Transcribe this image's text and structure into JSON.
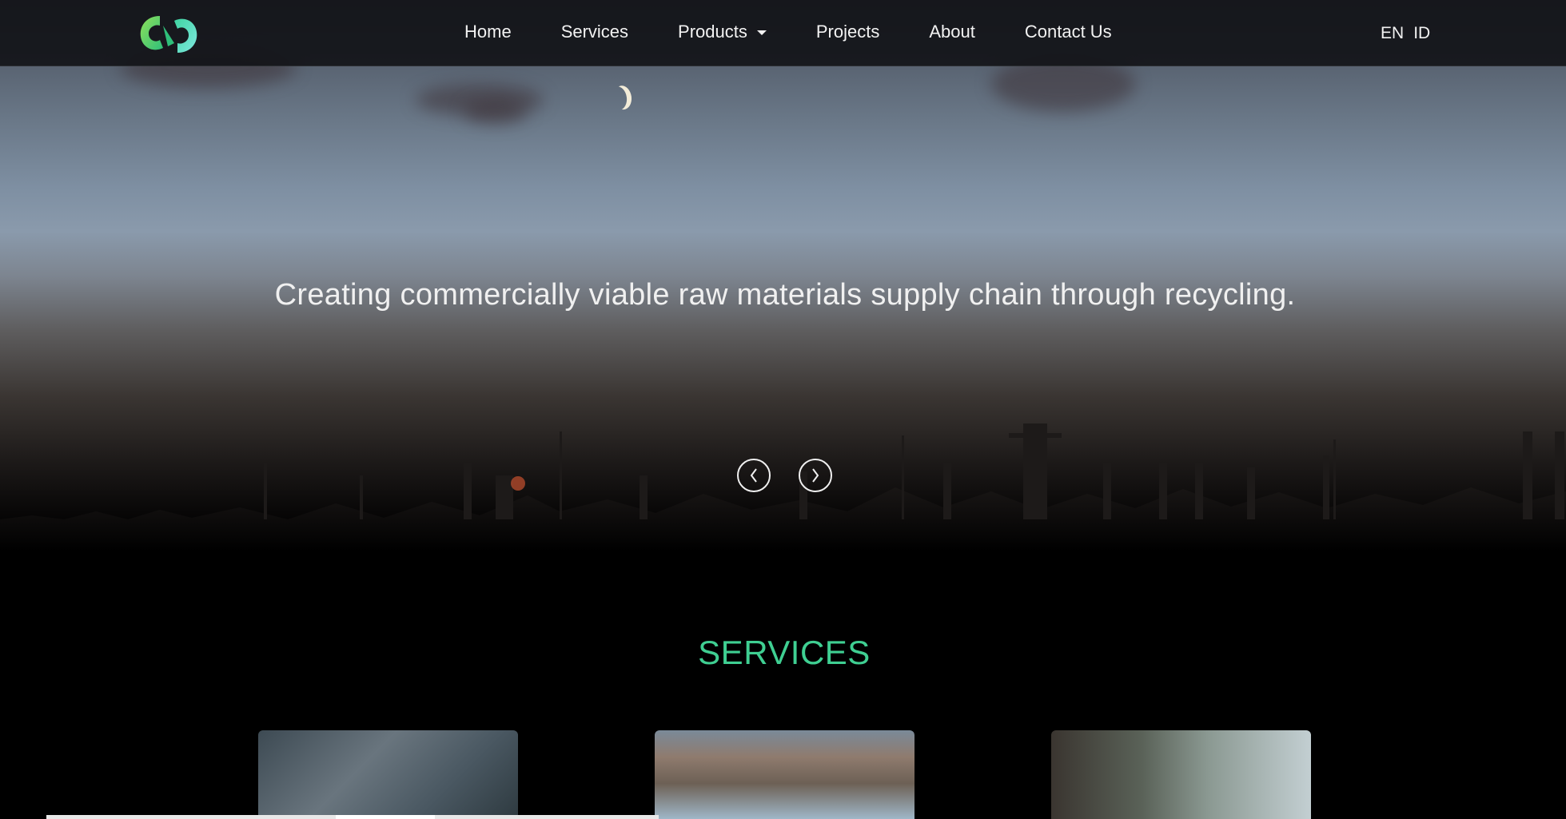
{
  "brand": {
    "logo_icon": "recycle-loop-logo-icon",
    "accent_color": "#3fcf92"
  },
  "nav": {
    "items": [
      {
        "label": "Home"
      },
      {
        "label": "Services"
      },
      {
        "label": "Products"
      },
      {
        "label": "Projects"
      },
      {
        "label": "About"
      },
      {
        "label": "Contact Us"
      }
    ],
    "languages": [
      "EN",
      "ID"
    ]
  },
  "hero": {
    "tagline": "Creating commercially viable raw materials supply chain through recycling.",
    "prev_icon": "chevron-left-icon",
    "next_icon": "chevron-right-icon"
  },
  "services": {
    "heading": "SERVICES"
  }
}
